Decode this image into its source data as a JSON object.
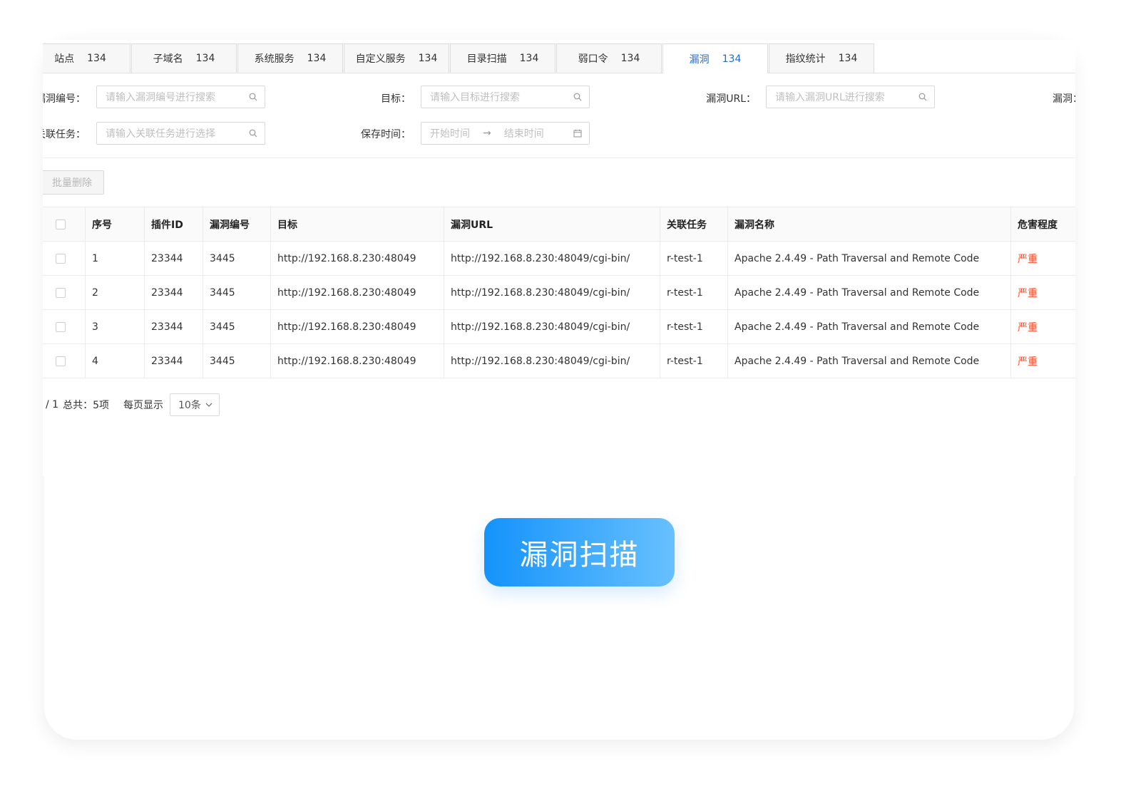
{
  "tabs": [
    {
      "label": "站点",
      "count": "134"
    },
    {
      "label": "子域名",
      "count": "134"
    },
    {
      "label": "系统服务",
      "count": "134"
    },
    {
      "label": "自定义服务",
      "count": "134"
    },
    {
      "label": "目录扫描",
      "count": "134"
    },
    {
      "label": "弱口令",
      "count": "134"
    },
    {
      "label": "漏洞",
      "count": "134",
      "active": true
    },
    {
      "label": "指纹统计",
      "count": "134"
    }
  ],
  "filters": {
    "vuln_id": {
      "label": "漏洞编号：",
      "placeholder": "请输入漏洞编号进行搜索"
    },
    "target": {
      "label": "目标：",
      "placeholder": "请输入目标进行搜索"
    },
    "vuln_url": {
      "label": "漏洞URL：",
      "placeholder": "请输入漏洞URL进行搜索"
    },
    "vuln_more": {
      "label": "漏洞："
    },
    "task": {
      "label": "关联任务：",
      "placeholder": "请输入关联任务进行选择"
    },
    "save_time": {
      "label": "保存时间：",
      "start_placeholder": "开始时间",
      "end_placeholder": "结束时间",
      "arrow": "→"
    }
  },
  "toolbar": {
    "batch_delete": "批量删除"
  },
  "table": {
    "headers": [
      "序号",
      "插件ID",
      "漏洞编号",
      "目标",
      "漏洞URL",
      "关联任务",
      "漏洞名称",
      "危害程度"
    ],
    "rows": [
      [
        "1",
        "23344",
        "3445",
        "http://192.168.8.230:48049",
        "http://192.168.8.230:48049/cgi-bin/",
        "r-test-1",
        "Apache 2.4.49 - Path Traversal and Remote Code",
        "严重"
      ],
      [
        "2",
        "23344",
        "3445",
        "http://192.168.8.230:48049",
        "http://192.168.8.230:48049/cgi-bin/",
        "r-test-1",
        "Apache 2.4.49 - Path Traversal and Remote Code",
        "严重"
      ],
      [
        "3",
        "23344",
        "3445",
        "http://192.168.8.230:48049",
        "http://192.168.8.230:48049/cgi-bin/",
        "r-test-1",
        "Apache 2.4.49 - Path Traversal and Remote Code",
        "严重"
      ],
      [
        "4",
        "23344",
        "3445",
        "http://192.168.8.230:48049",
        "http://192.168.8.230:48049/cgi-bin/",
        "r-test-1",
        "Apache 2.4.49 - Path Traversal and Remote Code",
        "严重"
      ]
    ],
    "severity_color": "#ff4d2e"
  },
  "pager": {
    "page_info": "/ 1",
    "total": "总共：5项",
    "per_page_label": "每页显示",
    "per_page_value": "10条"
  },
  "cta": {
    "label": "漏洞扫描"
  },
  "colors": {
    "accent": "#1e6bd6",
    "cta_from": "#1493fb",
    "cta_to": "#68c0fe"
  }
}
